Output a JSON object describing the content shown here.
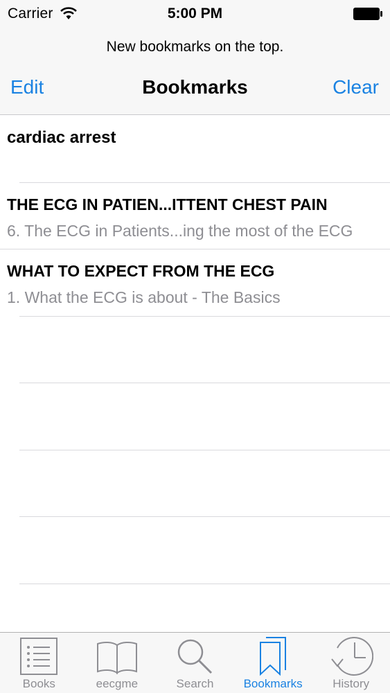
{
  "status_bar": {
    "carrier": "Carrier",
    "time": "5:00 PM"
  },
  "navbar": {
    "prompt": "New bookmarks on the top.",
    "title": "Bookmarks",
    "edit_label": "Edit",
    "clear_label": "Clear"
  },
  "bookmarks": [
    {
      "title": "cardiac arrest",
      "subtitle": ""
    },
    {
      "title": "THE ECG IN PATIEN...ITTENT CHEST PAIN",
      "subtitle": "6. The ECG in Patients...ing the most of the ECG"
    },
    {
      "title": "WHAT TO EXPECT FROM THE ECG",
      "subtitle": "1. What the ECG is about - The Basics"
    }
  ],
  "tabs": [
    {
      "label": "Books",
      "icon": "list-icon",
      "active": false
    },
    {
      "label": "eecgme",
      "icon": "book-icon",
      "active": false
    },
    {
      "label": "Search",
      "icon": "magnifier-icon",
      "active": false
    },
    {
      "label": "Bookmarks",
      "icon": "bookmarks-icon",
      "active": true
    },
    {
      "label": "History",
      "icon": "clock-history-icon",
      "active": false
    }
  ],
  "colors": {
    "accent": "#1a82e2",
    "inactive": "#8e8e93"
  }
}
